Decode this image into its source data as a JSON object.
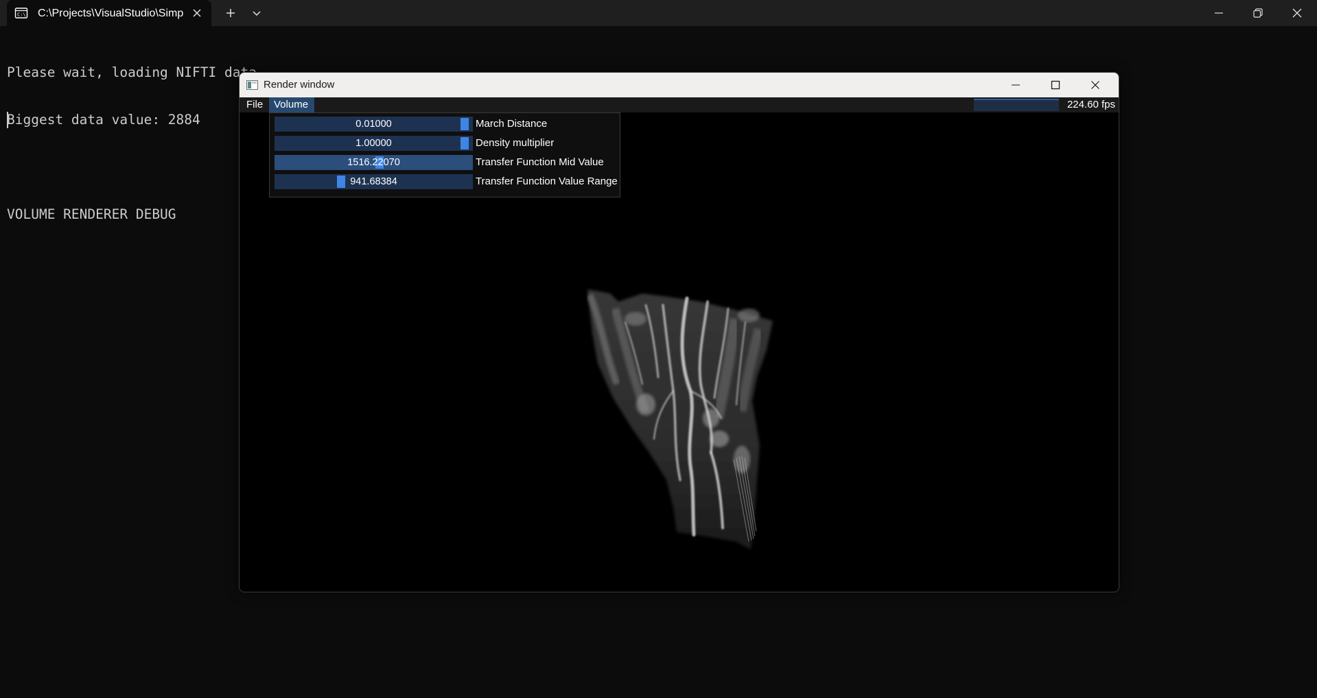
{
  "terminal": {
    "tab_title": "C:\\Projects\\VisualStudio\\Simp",
    "icons": {
      "tab": "terminal-icon",
      "close": "close-icon",
      "new_tab": "plus-icon",
      "dropdown": "chevron-down-icon",
      "minimize": "minimize-icon",
      "restore": "restore-icon",
      "window_close": "close-icon"
    },
    "console_lines": [
      "Please wait, loading NIFTI data...",
      "Biggest data value: 2884",
      "",
      "VOLUME RENDERER DEBUG"
    ]
  },
  "render_window": {
    "title": "Render window",
    "icons": {
      "app": "window-app-icon",
      "minimize": "minimize-icon",
      "maximize": "maximize-icon",
      "close": "close-icon"
    },
    "menu": [
      {
        "label": "File",
        "active": false
      },
      {
        "label": "Volume",
        "active": true
      }
    ],
    "fps": "224.60 fps",
    "controls": [
      {
        "value": "0.01000",
        "label": "March Distance",
        "position": 0.98
      },
      {
        "value": "1.00000",
        "label": "Density multiplier",
        "position": 0.98
      },
      {
        "value": "1516.22070",
        "label": "Transfer Function Mid Value",
        "position": 0.53
      },
      {
        "value": "941.68384",
        "label": "Transfer Function Value Range",
        "position": 0.33
      }
    ],
    "colors": {
      "slider_bg": "#1d3251",
      "slider_active_bg": "#2b4e7d",
      "grab": "#3f86e4",
      "menu_active": "#28496f"
    }
  }
}
